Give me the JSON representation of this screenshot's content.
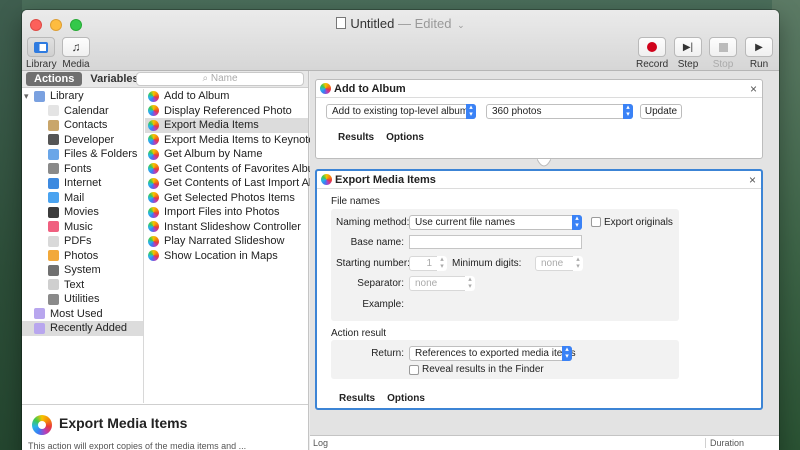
{
  "window": {
    "title": "Untitled",
    "status": "— Edited"
  },
  "toolbar": {
    "library_label": "Library",
    "media_label": "Media",
    "record_label": "Record",
    "step_label": "Step",
    "stop_label": "Stop",
    "run_label": "Run"
  },
  "left": {
    "tabs": {
      "actions": "Actions",
      "variables": "Variables"
    },
    "search_placeholder": "Name",
    "library": [
      {
        "label": "Library",
        "icon": "library-icon",
        "color": "#7aa1e0"
      },
      {
        "label": "Calendar",
        "icon": "calendar-icon",
        "color": "#e4e4e4"
      },
      {
        "label": "Contacts",
        "icon": "contacts-icon",
        "color": "#c9a66b"
      },
      {
        "label": "Developer",
        "icon": "developer-icon",
        "color": "#555555"
      },
      {
        "label": "Files & Folders",
        "icon": "folder-icon",
        "color": "#6aa6e8"
      },
      {
        "label": "Fonts",
        "icon": "fonts-icon",
        "color": "#8a8a8a"
      },
      {
        "label": "Internet",
        "icon": "internet-icon",
        "color": "#3d8ae0"
      },
      {
        "label": "Mail",
        "icon": "mail-icon",
        "color": "#4aa3f0"
      },
      {
        "label": "Movies",
        "icon": "movies-icon",
        "color": "#3c3c3c"
      },
      {
        "label": "Music",
        "icon": "music-icon",
        "color": "#f06080"
      },
      {
        "label": "PDFs",
        "icon": "pdf-icon",
        "color": "#d9d9d9"
      },
      {
        "label": "Photos",
        "icon": "photos-icon",
        "color": "#f2a93b"
      },
      {
        "label": "System",
        "icon": "system-icon",
        "color": "#707070"
      },
      {
        "label": "Text",
        "icon": "text-icon",
        "color": "#cfcfcf"
      },
      {
        "label": "Utilities",
        "icon": "utilities-icon",
        "color": "#8a8a8a"
      },
      {
        "label": "Most Used",
        "icon": "smart-folder-icon",
        "color": "#b8a6ee"
      },
      {
        "label": "Recently Added",
        "icon": "smart-folder-icon",
        "color": "#b8a6ee"
      }
    ],
    "actions": [
      "Add to Album",
      "Display Referenced Photo",
      "Export Media Items",
      "Export Media Items to Keynote",
      "Get Album by Name",
      "Get Contents of Favorites Album",
      "Get Contents of Last Import Album",
      "Get Selected Photos Items",
      "Import Files into Photos",
      "Instant Slideshow Controller",
      "Play Narrated Slideshow",
      "Show Location in Maps"
    ],
    "description": {
      "title": "Export Media Items",
      "text": "This action will export copies of the media items and ..."
    }
  },
  "workflow": {
    "card1": {
      "title": "Add to Album",
      "mode": "Add to existing top-level album...",
      "album": "360 photos",
      "update": "Update",
      "tab_results": "Results",
      "tab_options": "Options"
    },
    "card2": {
      "title": "Export Media Items",
      "file_names_heading": "File names",
      "naming_method_label": "Naming method:",
      "naming_method": "Use current file names",
      "export_originals": "Export originals",
      "base_name_label": "Base name:",
      "starting_number_label": "Starting number:",
      "starting_number": "1",
      "minimum_digits_label": "Minimum digits:",
      "minimum_digits": "none",
      "separator_label": "Separator:",
      "separator": "none",
      "example_label": "Example:",
      "action_result_heading": "Action result",
      "return_label": "Return:",
      "return_value": "References to exported media items",
      "reveal": "Reveal results in the Finder",
      "tab_results": "Results",
      "tab_options": "Options"
    }
  },
  "log": {
    "log_label": "Log",
    "duration_label": "Duration"
  }
}
